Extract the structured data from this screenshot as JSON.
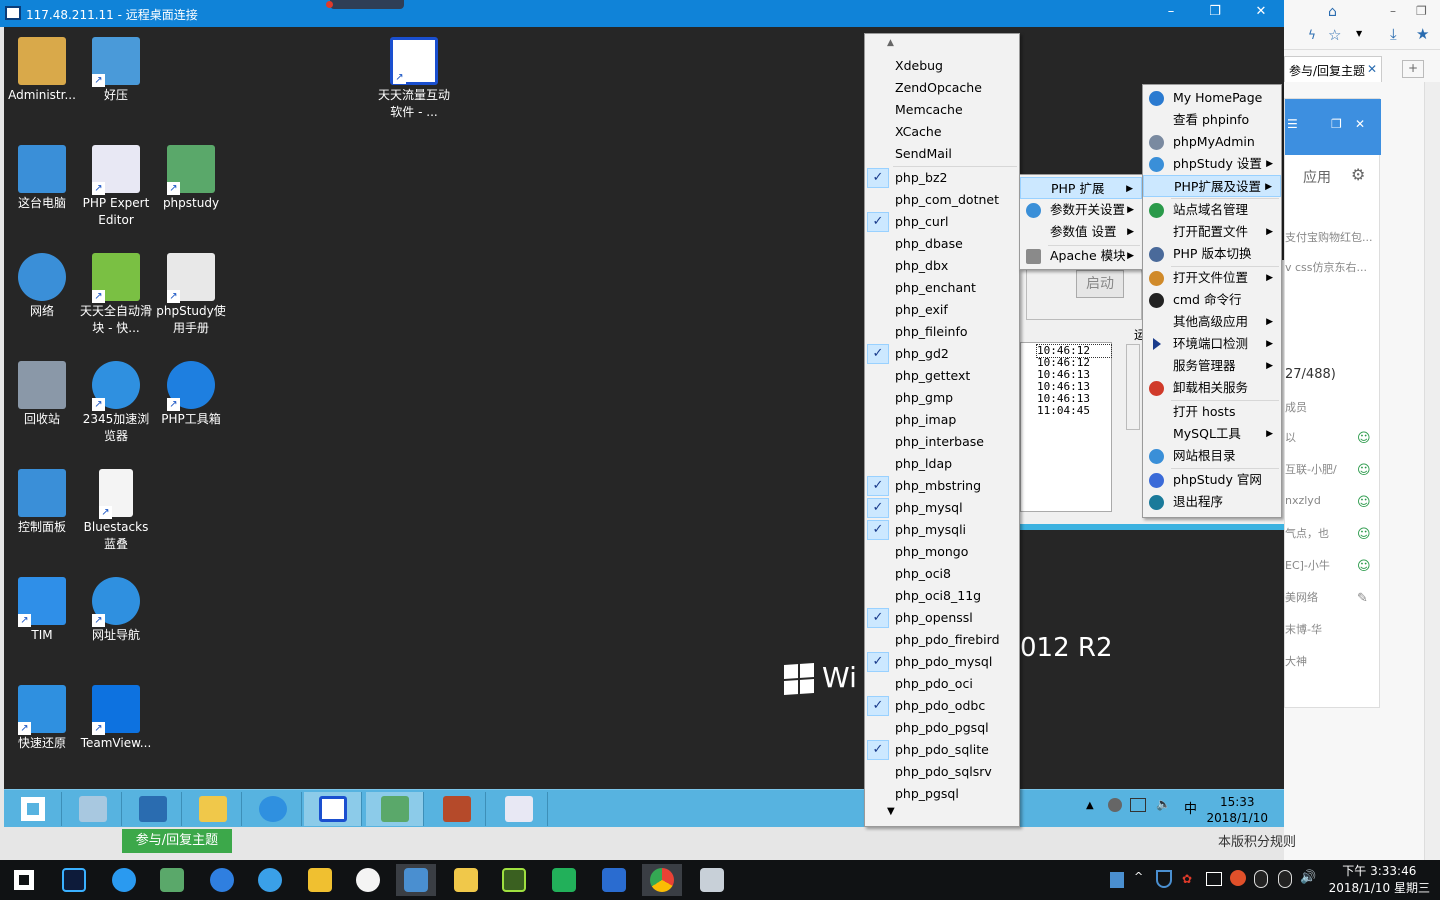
{
  "rdp": {
    "title": "117.48.211.11 - 远程桌面连接",
    "minimize": "–",
    "restore": "❐",
    "close": "✕"
  },
  "desktop_icons": [
    {
      "label": "Administr...",
      "color": "#d9a94a"
    },
    {
      "label": "好压",
      "color": "#4a9ad9"
    },
    {
      "label": "天天流量互动软件 - ...",
      "color": "#1a4fcf"
    },
    {
      "label": "这台电脑",
      "color": "#3a8fd8"
    },
    {
      "label": "PHP Expert Editor",
      "color": "#e8e8f4"
    },
    {
      "label": "phpstudy",
      "color": "#5aa86a"
    },
    {
      "label": "网络",
      "color": "#3a8fd8"
    },
    {
      "label": "天天全自动滑块 - 快...",
      "color": "#7ac043"
    },
    {
      "label": "phpStudy使用手册",
      "color": "#e8e8e8"
    },
    {
      "label": "回收站",
      "color": "#8a98a8"
    },
    {
      "label": "2345加速浏览器",
      "color": "#2f90e0"
    },
    {
      "label": "PHP工具箱",
      "color": "#1e7fe0"
    },
    {
      "label": "控制面板",
      "color": "#3a8fd8"
    },
    {
      "label": "Bluestacks 蓝叠",
      "color": "#f4f4f4"
    },
    {
      "label": "TIM",
      "color": "#2f8fe8"
    },
    {
      "label": "网址导航",
      "color": "#2f90e0"
    },
    {
      "label": "快速还原",
      "color": "#2f90e0"
    },
    {
      "label": "TeamView...",
      "color": "#0d72e0"
    }
  ],
  "desktop_watermark": "Wi",
  "desktop_watermark2": "012 R2",
  "php_extensions": {
    "header": [
      "Xdebug",
      "ZendOpcache",
      "Memcache",
      "XCache",
      "SendMail"
    ],
    "items": [
      {
        "label": "php_bz2",
        "checked": true
      },
      {
        "label": "php_com_dotnet",
        "checked": false
      },
      {
        "label": "php_curl",
        "checked": true
      },
      {
        "label": "php_dbase",
        "checked": false
      },
      {
        "label": "php_dbx",
        "checked": false
      },
      {
        "label": "php_enchant",
        "checked": false
      },
      {
        "label": "php_exif",
        "checked": false
      },
      {
        "label": "php_fileinfo",
        "checked": false
      },
      {
        "label": "php_gd2",
        "checked": true
      },
      {
        "label": "php_gettext",
        "checked": false
      },
      {
        "label": "php_gmp",
        "checked": false
      },
      {
        "label": "php_imap",
        "checked": false
      },
      {
        "label": "php_interbase",
        "checked": false
      },
      {
        "label": "php_ldap",
        "checked": false
      },
      {
        "label": "php_mbstring",
        "checked": true
      },
      {
        "label": "php_mysql",
        "checked": true
      },
      {
        "label": "php_mysqli",
        "checked": true
      },
      {
        "label": "php_mongo",
        "checked": false
      },
      {
        "label": "php_oci8",
        "checked": false
      },
      {
        "label": "php_oci8_11g",
        "checked": false
      },
      {
        "label": "php_openssl",
        "checked": true
      },
      {
        "label": "php_pdo_firebird",
        "checked": false
      },
      {
        "label": "php_pdo_mysql",
        "checked": true
      },
      {
        "label": "php_pdo_oci",
        "checked": false
      },
      {
        "label": "php_pdo_odbc",
        "checked": true
      },
      {
        "label": "php_pdo_pgsql",
        "checked": false
      },
      {
        "label": "php_pdo_sqlite",
        "checked": true
      },
      {
        "label": "php_pdo_sqlsrv",
        "checked": false
      },
      {
        "label": "php_pgsql",
        "checked": false
      }
    ],
    "scroll_up": "▲",
    "scroll_down": "▼"
  },
  "php_submenu": {
    "items": [
      "PHP 扩展",
      "参数开关设置",
      "参数值 设置",
      "Apache 模块"
    ]
  },
  "main_menu": {
    "items": [
      "My HomePage",
      "查看 phpinfo",
      "phpMyAdmin",
      "phpStudy 设置",
      "PHP扩展及设置",
      "站点域名管理",
      "打开配置文件",
      "PHP 版本切换",
      "打开文件位置",
      "cmd 命令行",
      "其他高级应用",
      "环境端口检测",
      "服务管理器",
      "卸载相关服务",
      "打开 hosts",
      "MySQL工具",
      "网站根目录",
      "phpStudy 官网",
      "退出程序"
    ]
  },
  "phpstudy_window": {
    "start_button": "启动",
    "side_label": "运",
    "log": [
      "10:46:12",
      "10:46:12",
      "10:46:13",
      "10:46:13",
      "10:46:13",
      "11:04:45"
    ]
  },
  "remote_taskbar": {
    "time": "15:33",
    "date": "2018/1/10"
  },
  "browser": {
    "tab_title": "参与/回复主题",
    "tab_close": "✕",
    "new_tab": "+",
    "app_label": "应用",
    "list": [
      "支付宝购物红包...",
      "v css仿京东右..."
    ],
    "count": "27/488)",
    "member_label": "成员",
    "members": [
      "以",
      "互联-小肥/",
      "nxzlyd",
      "气点，也",
      "EC]-小牛",
      "美网络",
      "末博-华",
      "大神"
    ],
    "reply_button": "参与/回复主题",
    "rules_link": "本版积分规则"
  },
  "host_taskbar": {
    "time": "下午 3:33:46",
    "date": "2018/1/10 星期三"
  }
}
